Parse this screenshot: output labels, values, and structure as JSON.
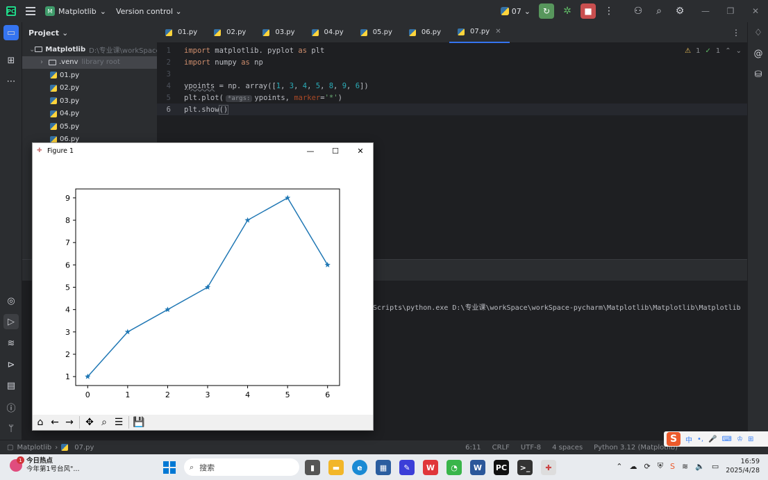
{
  "titlebar": {
    "project_badge": "M",
    "project_name": "Matplotlib",
    "version_control": "Version control",
    "run_config": "07"
  },
  "project_pane": {
    "header": "Project",
    "root_name": "Matplotlib",
    "root_path": "D:\\专业课\\workSpace\\w",
    "items": [
      {
        "label": ".venv",
        "note": "library root"
      },
      {
        "label": "01.py"
      },
      {
        "label": "02.py"
      },
      {
        "label": "03.py"
      },
      {
        "label": "04.py"
      },
      {
        "label": "05.py"
      },
      {
        "label": "06.py"
      }
    ]
  },
  "tabs": [
    "01.py",
    "02.py",
    "03.py",
    "04.py",
    "05.py",
    "06.py",
    "07.py"
  ],
  "active_tab": "07.py",
  "editor": {
    "line_numbers": [
      "1",
      "2",
      "3",
      "4",
      "5",
      "6"
    ],
    "inlay_hint": "*args:",
    "warnings": "1",
    "checks": "1"
  },
  "run_output": "Scripts\\python.exe D:\\专业课\\workSpace\\workSpace-pycharm\\Matplotlib\\Matplotlib\\Matplotlib",
  "statusbar": {
    "crumb_project": "Matplotlib",
    "crumb_file": "07.py",
    "position": "6:11",
    "line_sep": "CRLF",
    "encoding": "UTF-8",
    "indent": "4 spaces",
    "interpreter": "Python 3.12 (Matplotlib)"
  },
  "ime": {
    "logo": "S",
    "mode": "中"
  },
  "figure": {
    "title": "Figure 1"
  },
  "chart_data": {
    "type": "line",
    "x": [
      0,
      1,
      2,
      3,
      4,
      5,
      6
    ],
    "values": [
      1,
      3,
      4,
      5,
      8,
      9,
      6
    ],
    "marker": "*",
    "xticks": [
      "0",
      "1",
      "2",
      "3",
      "4",
      "5",
      "6"
    ],
    "yticks": [
      "1",
      "2",
      "3",
      "4",
      "5",
      "6",
      "7",
      "8",
      "9"
    ],
    "xlim": [
      -0.3,
      6.3
    ],
    "ylim": [
      0.6,
      9.4
    ],
    "color": "#1f77b4",
    "grid": false
  },
  "taskbar": {
    "news_title": "今日热点",
    "news_sub": "今年第1号台风\"...",
    "news_badge": "1",
    "search_placeholder": "搜索",
    "time": "16:59",
    "date": "2025/4/28"
  }
}
